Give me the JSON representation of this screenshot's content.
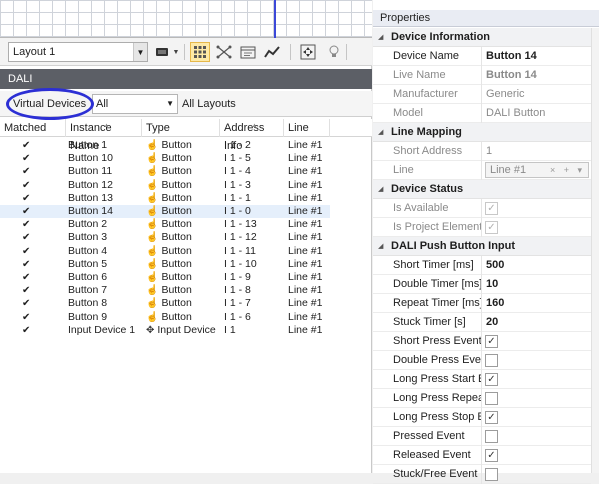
{
  "toolbar": {
    "layout_value": "Layout 1"
  },
  "panel": {
    "dali_title": "DALI",
    "tab_label": "Virtual Devices",
    "filter_value": "All",
    "layouts_label": "All Layouts"
  },
  "columns": [
    "Matched",
    "Instance Name",
    "Type",
    "Address Info",
    "Line"
  ],
  "rows": [
    {
      "matched": "✔",
      "name": "Button 1",
      "type": "Button",
      "addr": "I 1 - 2",
      "line": "Line #1"
    },
    {
      "matched": "✔",
      "name": "Button 10",
      "type": "Button",
      "addr": "I 1 - 5",
      "line": "Line #1"
    },
    {
      "matched": "✔",
      "name": "Button 11",
      "type": "Button",
      "addr": "I 1 - 4",
      "line": "Line #1"
    },
    {
      "matched": "✔",
      "name": "Button 12",
      "type": "Button",
      "addr": "I 1 - 3",
      "line": "Line #1"
    },
    {
      "matched": "✔",
      "name": "Button 13",
      "type": "Button",
      "addr": "I 1 - 1",
      "line": "Line #1"
    },
    {
      "matched": "✔",
      "name": "Button 14",
      "type": "Button",
      "addr": "I 1 - 0",
      "line": "Line #1"
    },
    {
      "matched": "✔",
      "name": "Button 2",
      "type": "Button",
      "addr": "I 1 - 13",
      "line": "Line #1"
    },
    {
      "matched": "✔",
      "name": "Button 3",
      "type": "Button",
      "addr": "I 1 - 12",
      "line": "Line #1"
    },
    {
      "matched": "✔",
      "name": "Button 4",
      "type": "Button",
      "addr": "I 1 - 11",
      "line": "Line #1"
    },
    {
      "matched": "✔",
      "name": "Button 5",
      "type": "Button",
      "addr": "I 1 - 10",
      "line": "Line #1"
    },
    {
      "matched": "✔",
      "name": "Button 6",
      "type": "Button",
      "addr": "I 1 - 9",
      "line": "Line #1"
    },
    {
      "matched": "✔",
      "name": "Button 7",
      "type": "Button",
      "addr": "I 1 - 8",
      "line": "Line #1"
    },
    {
      "matched": "✔",
      "name": "Button 8",
      "type": "Button",
      "addr": "I 1 - 7",
      "line": "Line #1"
    },
    {
      "matched": "✔",
      "name": "Button 9",
      "type": "Button",
      "addr": "I 1 - 6",
      "line": "Line #1"
    },
    {
      "matched": "✔",
      "name": "Input Device 1",
      "type": "Input Device",
      "addr": "I 1",
      "line": "Line #1"
    }
  ],
  "selected_row_index": 5,
  "properties": {
    "title": "Properties",
    "device_info": {
      "header": "Device Information",
      "device_name_label": "Device Name",
      "device_name_value": "Button 14",
      "live_name_label": "Live Name",
      "live_name_value": "Button 14",
      "manufacturer_label": "Manufacturer",
      "manufacturer_value": "Generic",
      "model_label": "Model",
      "model_value": "DALI Button"
    },
    "line_mapping": {
      "header": "Line Mapping",
      "short_address_label": "Short Address",
      "short_address_value": "1",
      "line_label": "Line",
      "line_value": "Line #1",
      "line_controls": "× + ▾"
    },
    "device_status": {
      "header": "Device Status",
      "is_available_label": "Is Available",
      "is_available": true,
      "is_project_label": "Is Project Element",
      "is_project": true
    },
    "push_button": {
      "header": "DALI Push Button Input",
      "short_timer_label": "Short Timer [ms]",
      "short_timer_value": "500",
      "double_timer_label": "Double Timer [ms]",
      "double_timer_value": "10",
      "repeat_timer_label": "Repeat Timer [ms]",
      "repeat_timer_value": "160",
      "stuck_timer_label": "Stuck Timer [s]",
      "stuck_timer_value": "20",
      "short_press_label": "Short Press Event",
      "short_press": true,
      "double_press_label": "Double Press Event",
      "double_press": false,
      "long_start_label": "Long Press Start Eve",
      "long_start": true,
      "long_repeat_label": "Long Press Repeat I",
      "long_repeat": false,
      "long_stop_label": "Long Press Stop Eve",
      "long_stop": true,
      "pressed_label": "Pressed Event",
      "pressed": false,
      "released_label": "Released Event",
      "released": true,
      "stuck_free_label": "Stuck/Free Event",
      "stuck_free": false
    }
  },
  "icons": {
    "checkbox_glyph": "✔",
    "button_type_icon": "hand-pointer-icon",
    "input_device_icon": "move-arrows-icon"
  }
}
